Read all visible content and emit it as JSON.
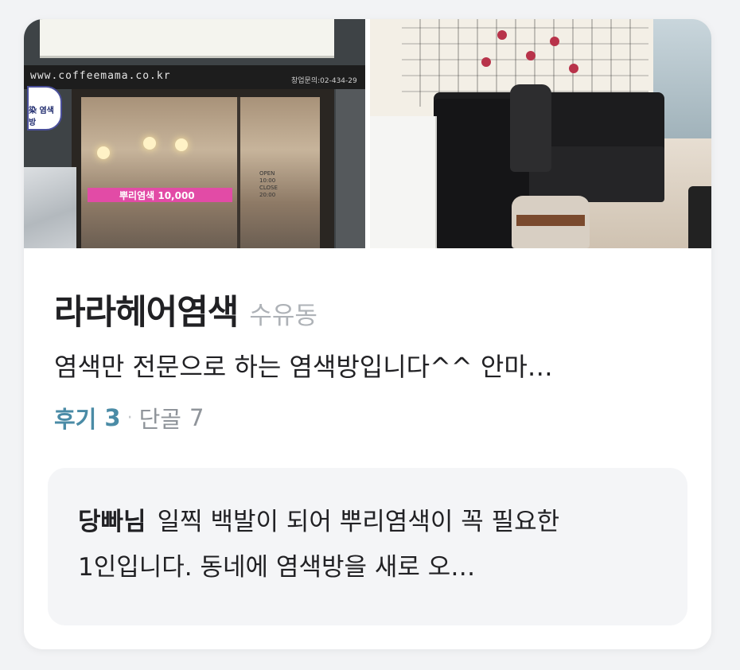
{
  "shop": {
    "name": "라라헤어염색",
    "region": "수유동",
    "description": "염색만 전문으로 하는 염색방입니다^^ 안마…"
  },
  "stats": {
    "review_label": "후기",
    "review_count": "3",
    "separator": "·",
    "regular_label": "단골",
    "regular_count": "7"
  },
  "review": {
    "author": "당빠님",
    "text": "일찍 백발이 되어 뿌리염색이 꼭 필요한 1인입니다. 동네에 염색방을 새로 오…"
  },
  "photos": {
    "storefront": {
      "url_text": "www.coffeemama.co.kr",
      "phone_text": "창업문의:02-434-29",
      "price_sign": "뿌리염색 10,000",
      "hours_text": "OPEN 10:00 CLOSE 20:00",
      "logo_text": "染 염색방"
    }
  },
  "colors": {
    "accent": "#4a8ba6",
    "text": "#212124",
    "muted": "#aeb2b7",
    "card_bg": "#ffffff",
    "review_bg": "#f4f5f7"
  }
}
